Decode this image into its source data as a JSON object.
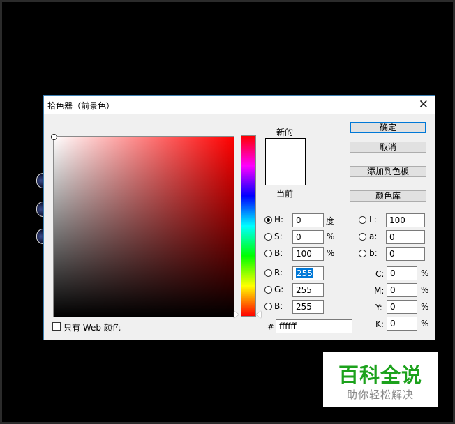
{
  "dialog": {
    "title": "拾色器（前景色）",
    "close_symbol": "✕",
    "new_label": "新的",
    "current_label": "当前",
    "new_color": "#ffffff",
    "current_color": "#ffffff",
    "buttons": {
      "ok": "确定",
      "cancel": "取消",
      "add_to_swatches": "添加到色板",
      "color_libraries": "颜色库"
    },
    "hsb": {
      "h": {
        "label": "H:",
        "value": "0",
        "unit": "度",
        "checked": true
      },
      "s": {
        "label": "S:",
        "value": "0",
        "unit": "%"
      },
      "b": {
        "label": "B:",
        "value": "100",
        "unit": "%"
      }
    },
    "rgb": {
      "r": {
        "label": "R:",
        "value": "255"
      },
      "g": {
        "label": "G:",
        "value": "255"
      },
      "b": {
        "label": "B:",
        "value": "255"
      }
    },
    "lab": {
      "l": {
        "label": "L:",
        "value": "100"
      },
      "a": {
        "label": "a:",
        "value": "0"
      },
      "b": {
        "label": "b:",
        "value": "0"
      }
    },
    "cmyk": {
      "c": {
        "label": "C:",
        "value": "0",
        "unit": "%"
      },
      "m": {
        "label": "M:",
        "value": "0",
        "unit": "%"
      },
      "y": {
        "label": "Y:",
        "value": "0",
        "unit": "%"
      },
      "k": {
        "label": "K:",
        "value": "0",
        "unit": "%"
      }
    },
    "hex": {
      "label": "#",
      "value": "ffffff"
    },
    "web_only_label": "只有 Web 颜色",
    "hue_color": "#ff0000"
  },
  "watermark": {
    "title": "百科全说",
    "subtitle": "助你轻松解决",
    "title_color": "#1ca21c"
  }
}
